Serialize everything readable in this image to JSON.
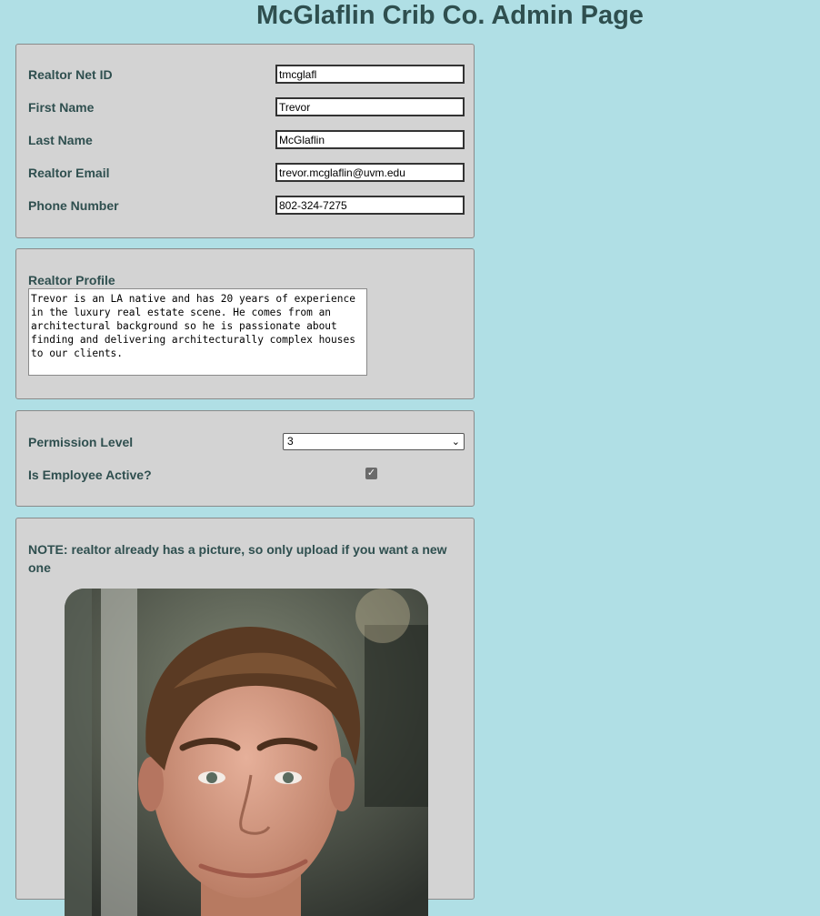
{
  "page": {
    "title": "McGlaflin Crib Co. Admin Page"
  },
  "fields": {
    "net_id": {
      "label": "Realtor Net ID",
      "value": "tmcglafl"
    },
    "first_name": {
      "label": "First Name",
      "value": "Trevor"
    },
    "last_name": {
      "label": "Last Name",
      "value": "McGlaflin"
    },
    "email": {
      "label": "Realtor Email",
      "value": "trevor.mcglaflin@uvm.edu"
    },
    "phone": {
      "label": "Phone Number",
      "value": "802-324-7275"
    }
  },
  "profile": {
    "label": "Realtor Profile",
    "text": "Trevor is an LA native and has 20 years of experience in the luxury real estate scene. He comes from an architectural background so he is passionate about finding and delivering architecturally complex houses to our clients."
  },
  "permissions": {
    "level_label": "Permission Level",
    "level_value": "3",
    "active_label": "Is Employee Active?",
    "active_checked": true
  },
  "picture": {
    "note": "NOTE: realtor already has a picture, so only upload if you want a new one"
  }
}
